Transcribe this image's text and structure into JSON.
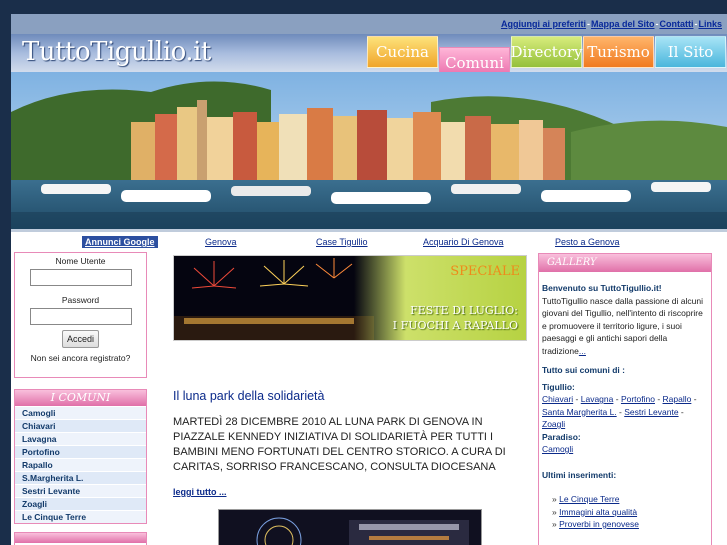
{
  "toplinks": [
    "Aggiungi ai preferiti",
    "Mappa del Sito",
    "Contatti",
    "Links"
  ],
  "toplinks_sep": "-",
  "logo": "TuttoTigullio.it",
  "tabs": [
    "Cucina",
    "Comuni",
    "Directory",
    "Turismo",
    "Il Sito"
  ],
  "adbar": {
    "annunci": "Annunci Google",
    "links": [
      "Genova",
      "Case Tigullio",
      "Acquario Di Genova",
      "Pesto a Genova"
    ]
  },
  "login": {
    "user_label": "Nome Utente",
    "password_label": "Password",
    "button": "Accedi",
    "register": "Non sei ancora registrato?"
  },
  "comuni": {
    "title": "I COMUNI",
    "items": [
      "Camogli",
      "Chiavari",
      "Lavagna",
      "Portofino",
      "Rapallo",
      "S.Margherita L.",
      "Sestri Levante",
      "Zoagli",
      "Le Cinque Terre"
    ]
  },
  "promo": {
    "speciale": "SPECIALE",
    "line1": "FESTE DI LUGLIO:",
    "line2": "I FUOCHI A RAPALLO"
  },
  "article": {
    "title": "Il luna park della solidarietà",
    "body": "MARTEDÌ 28 DICEMBRE 2010 AL LUNA PARK DI GENOVA IN PIAZZALE KENNEDY INIZIATIVA DI SOLIDARIETÀ PER TUTTI I BAMBINI MENO FORTUNATI DEL CENTRO STORICO. A CURA DI CARITAS, SORRISO FRANCESCANO, CONSULTA DIOCESANA",
    "readmore": "leggi tutto ..."
  },
  "sidebar": {
    "gallery": "GALLERY",
    "welcome_title": "Benvenuto su TuttoTigullio.it!",
    "welcome_text": "TuttoTigullio nasce dalla passione di alcuni giovani del Tigullio, nell'intento di riscoprire e promuovere il territorio ligure, i suoi paesaggi e gli antichi sapori della tradizione",
    "welcome_more": "...",
    "comuni_title": "Tutto sui comuni di :",
    "tigullio_label": "Tigullio:",
    "tigullio_links": [
      "Chiavari",
      "Lavagna",
      "Portofino",
      "Rapallo",
      "Santa Margherita L.",
      "Sestri Levante",
      "Zoagli"
    ],
    "paradiso_label": "Paradiso:",
    "paradiso_links": [
      "Camogli"
    ],
    "ultimi_title": "Ultimi inserimenti:",
    "ultimi": [
      "Le Cinque Terre",
      "Immagini alta qualità",
      "Proverbi in genovese"
    ]
  }
}
